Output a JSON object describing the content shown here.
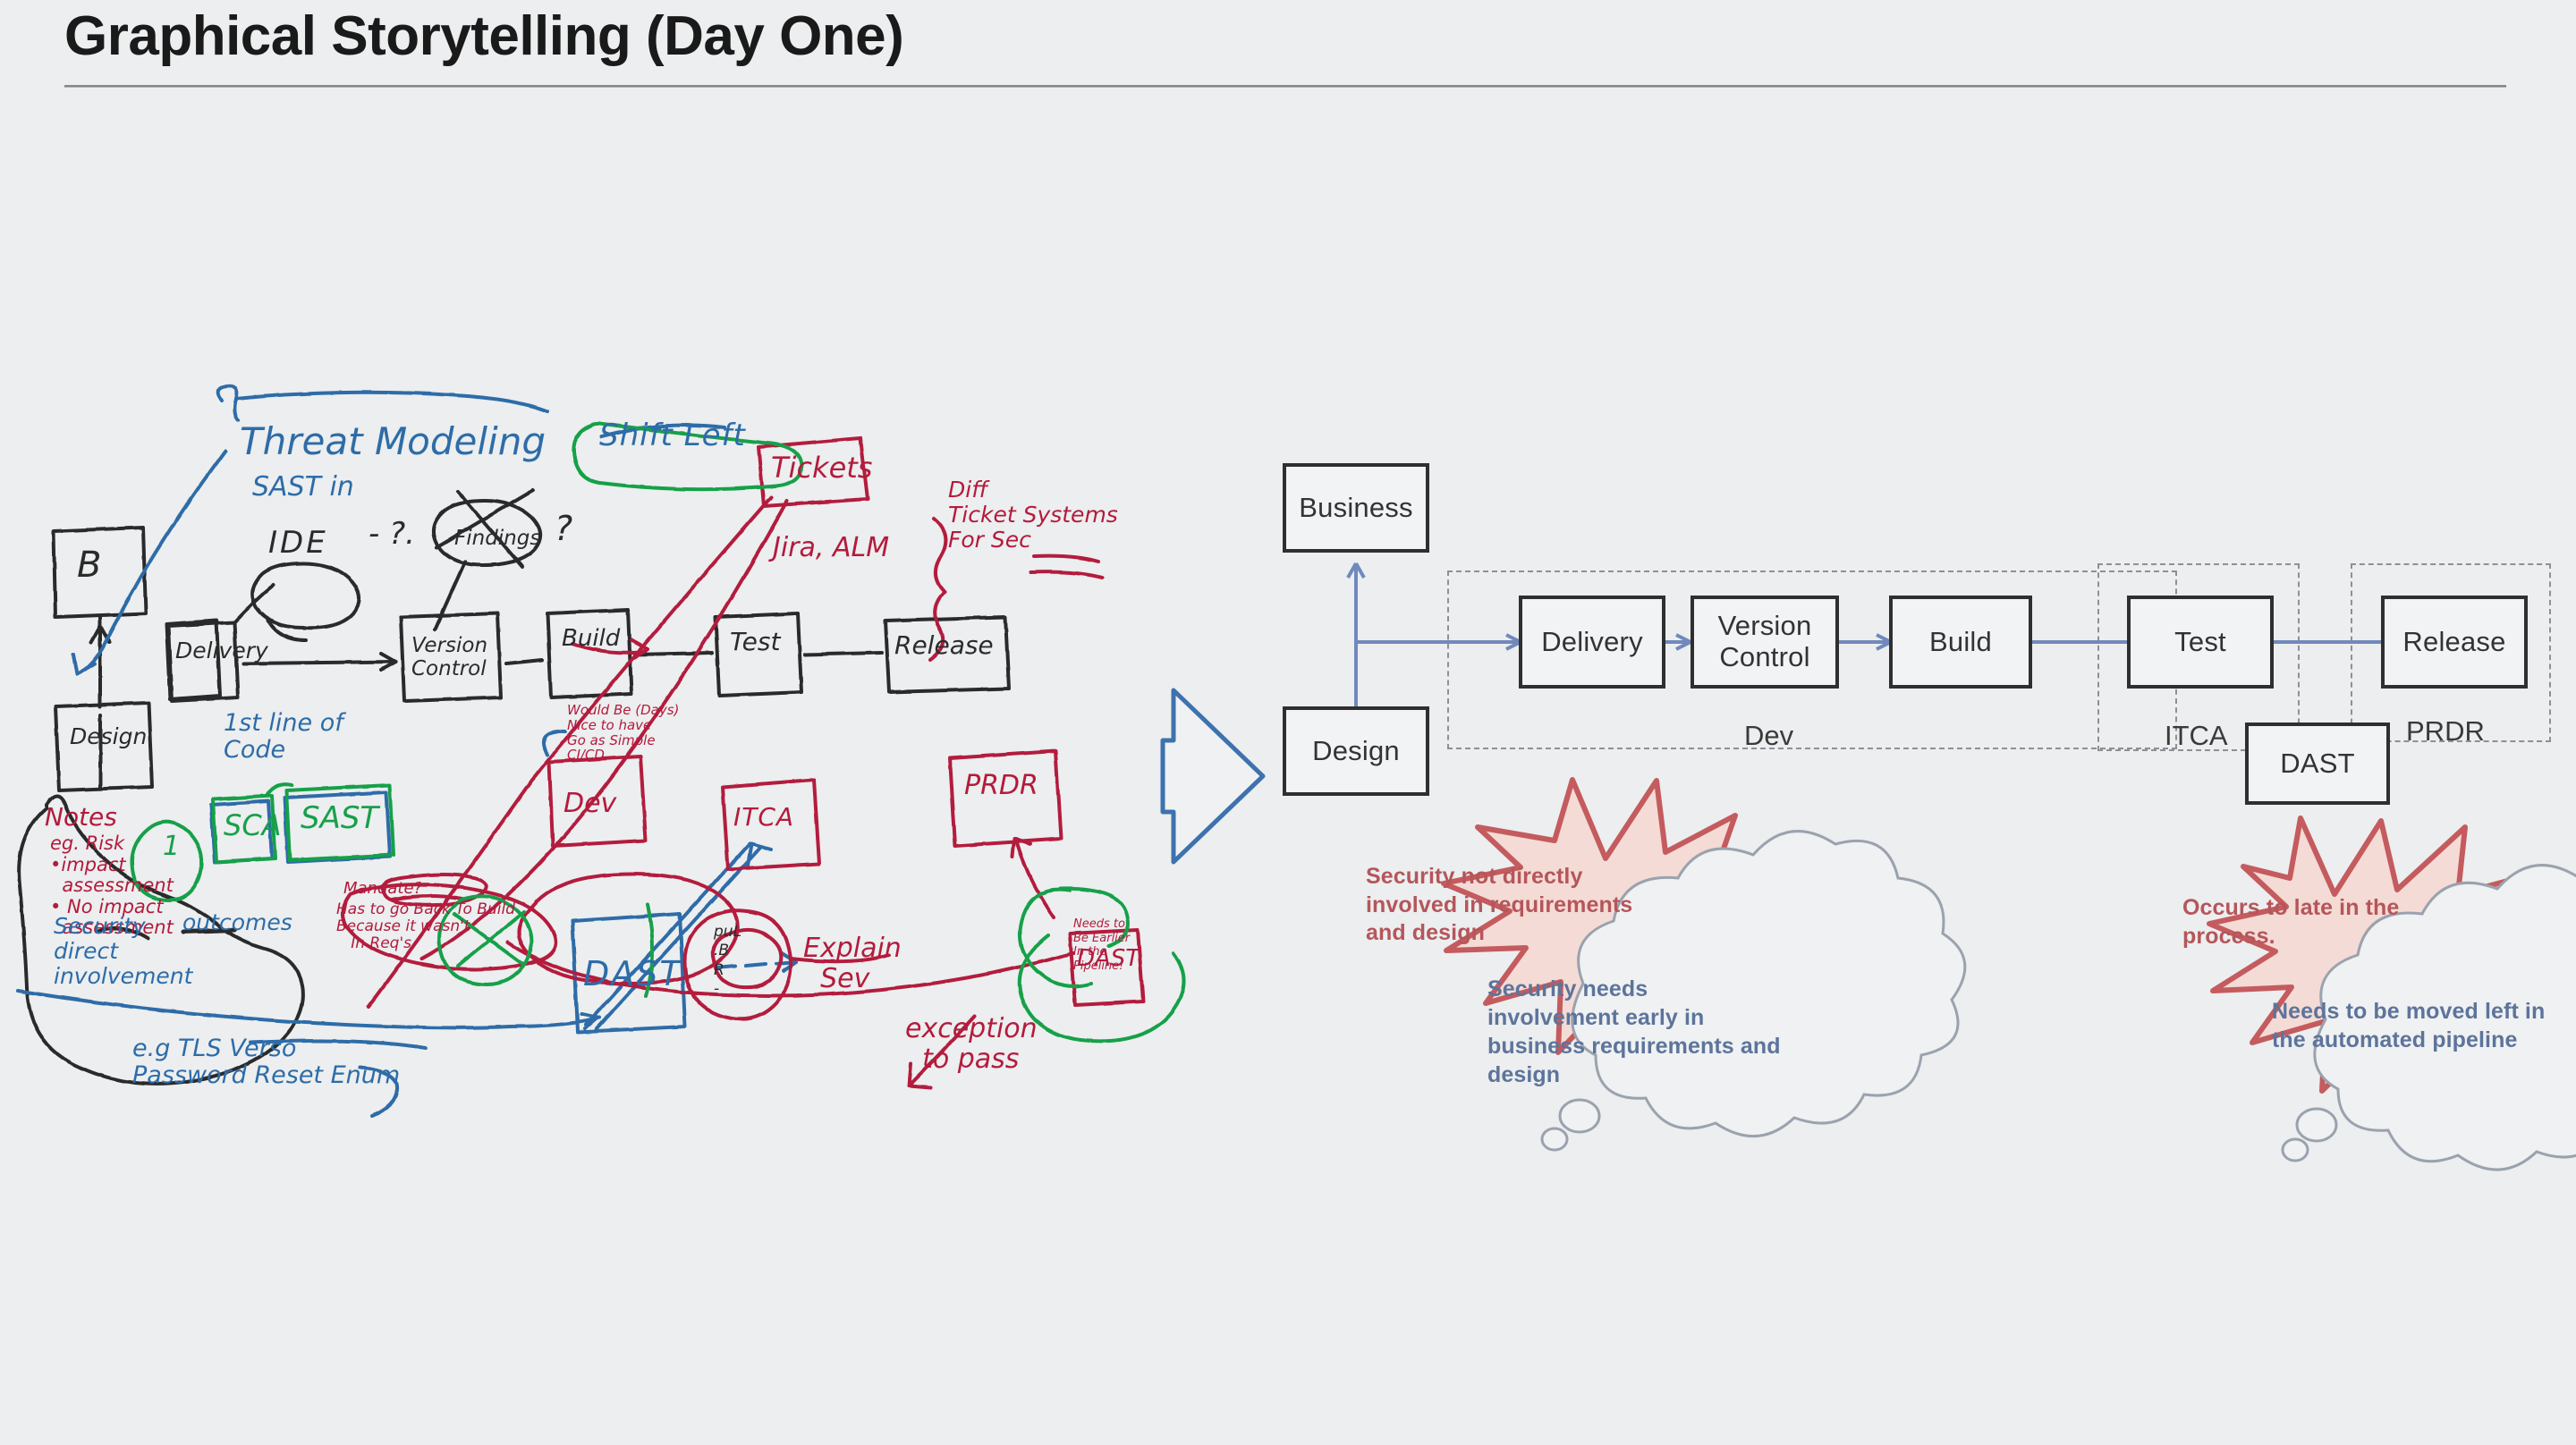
{
  "slide": {
    "title": "Graphical Storytelling (Day One)",
    "background_color": "#ECEEEF",
    "rule_color": "#6f7479"
  },
  "transition_arrow": {
    "icon": "right-arrow-icon",
    "color": "#3e72ae",
    "direction": "right"
  },
  "pipeline": {
    "accent_arrow_color": "#7089bd",
    "box_border_color": "#2f2f2f",
    "boxes": [
      {
        "id": "business",
        "label": "Business"
      },
      {
        "id": "design",
        "label": "Design"
      },
      {
        "id": "delivery",
        "label": "Delivery"
      },
      {
        "id": "version-control",
        "label": "Version\nControl"
      },
      {
        "id": "build",
        "label": "Build"
      },
      {
        "id": "test",
        "label": "Test"
      },
      {
        "id": "release",
        "label": "Release"
      },
      {
        "id": "dast",
        "label": "DAST"
      }
    ],
    "groups": [
      {
        "id": "dev",
        "label": "Dev"
      },
      {
        "id": "itca",
        "label": "ITCA"
      },
      {
        "id": "prdr",
        "label": "PRDR"
      }
    ]
  },
  "callouts": [
    {
      "id": "burst-left",
      "kind": "starburst",
      "text": "Security not directly\ninvolved in requirements\nand design",
      "fill": "#F4DBD5",
      "stroke": "#C45B5E",
      "text_color": "#b5565b"
    },
    {
      "id": "cloud-left",
      "kind": "thought-cloud",
      "text": "Security needs\ninvolvement early in\nbusiness requirements and\ndesign",
      "fill": "#EFF1F2",
      "stroke": "#9aa2ae",
      "text_color": "#5d749b"
    },
    {
      "id": "burst-right",
      "kind": "starburst",
      "text": "Occurs to late in the\nprocess.",
      "fill": "#F4DBD5",
      "stroke": "#C45B5E",
      "text_color": "#b5565b"
    },
    {
      "id": "cloud-right",
      "kind": "thought-cloud",
      "text": "Needs to be moved left in\nthe automated pipeline",
      "fill": "#EFF1F2",
      "stroke": "#9aa2ae",
      "text_color": "#5d749b"
    }
  ],
  "whiteboard": {
    "description": "Hand-drawn whiteboard sketch of a secure SDLC pipeline",
    "ink_colors": {
      "black": "#2b2b2b",
      "blue": "#2d6ca8",
      "red": "#b31b3c",
      "green": "#17a04a"
    },
    "notes": [
      {
        "id": "threat-modeling",
        "text": "Threat Modeling",
        "color": "blue"
      },
      {
        "id": "sast-in",
        "text": "SAST in",
        "color": "blue"
      },
      {
        "id": "ide-bubble",
        "text": "IDE",
        "color": "black"
      },
      {
        "id": "ide-question",
        "text": "- ?.",
        "color": "black"
      },
      {
        "id": "findings-bubble",
        "text": "Findings",
        "color": "black"
      },
      {
        "id": "findings-q",
        "text": "?",
        "color": "black"
      },
      {
        "id": "shift-left",
        "text": "Shift Left",
        "color": "blue"
      },
      {
        "id": "tickets",
        "text": "Tickets",
        "color": "red"
      },
      {
        "id": "jira-alm",
        "text": "Jira, ALM",
        "color": "red"
      },
      {
        "id": "diff-ticket",
        "text": "Diff\nTicket Systems\nFor Sec",
        "color": "red"
      },
      {
        "id": "box-b",
        "text": "B",
        "color": "black"
      },
      {
        "id": "box-design",
        "text": "Design",
        "color": "black"
      },
      {
        "id": "box-delivery",
        "text": "Delivery",
        "color": "black"
      },
      {
        "id": "box-version",
        "text": "Version\nControl",
        "color": "black"
      },
      {
        "id": "box-build",
        "text": "Build",
        "color": "black"
      },
      {
        "id": "box-test",
        "text": "Test",
        "color": "black"
      },
      {
        "id": "box-release",
        "text": "Release",
        "color": "black"
      },
      {
        "id": "first-line",
        "text": "1st line of\nCode",
        "color": "blue"
      },
      {
        "id": "sca",
        "text": "SCA",
        "color": "green"
      },
      {
        "id": "sast",
        "text": "SAST",
        "color": "green"
      },
      {
        "id": "notes-head",
        "text": "Notes",
        "color": "red"
      },
      {
        "id": "notes-body",
        "text": "eg. Risk\n•impact\n  assessment\n• No impact\n  assessment",
        "color": "red"
      },
      {
        "id": "notes-1",
        "text": "1",
        "color": "green"
      },
      {
        "id": "sec-direct",
        "text": "Security\ndirect\ninvolvement",
        "color": "blue"
      },
      {
        "id": "outcomes",
        "text": "outcomes",
        "color": "blue"
      },
      {
        "id": "tls-example",
        "text": "e.g TLS Verso\nPassword Reset Enum",
        "color": "blue"
      },
      {
        "id": "box-dev",
        "text": "Dev",
        "color": "red"
      },
      {
        "id": "dev-note",
        "text": "Would Be (Days)\nNice to have\nGo as Simple\nCI/CD",
        "color": "red"
      },
      {
        "id": "box-itca",
        "text": "ITCA",
        "color": "red"
      },
      {
        "id": "box-prdr",
        "text": "PRDR",
        "color": "red"
      },
      {
        "id": "box-dast-right",
        "text": "DAST",
        "color": "red"
      },
      {
        "id": "dast-right-note",
        "text": "Needs to\nBe Earlier\nIn the\nPipeline!",
        "color": "red"
      },
      {
        "id": "mandate",
        "text": "Mandate?",
        "color": "red"
      },
      {
        "id": "mandate-body",
        "text": "Has to go Back To Build\nBecause it wasn't\n   In Req's",
        "color": "red"
      },
      {
        "id": "box-dast-main",
        "text": "DAST",
        "color": "blue"
      },
      {
        "id": "pul-b-r",
        "text": "puL\n.B\nR\n-",
        "color": "black"
      },
      {
        "id": "explain-sev",
        "text": "Explain\n  Sev",
        "color": "red"
      },
      {
        "id": "exception",
        "text": "exception\n  to pass",
        "color": "red"
      }
    ]
  }
}
